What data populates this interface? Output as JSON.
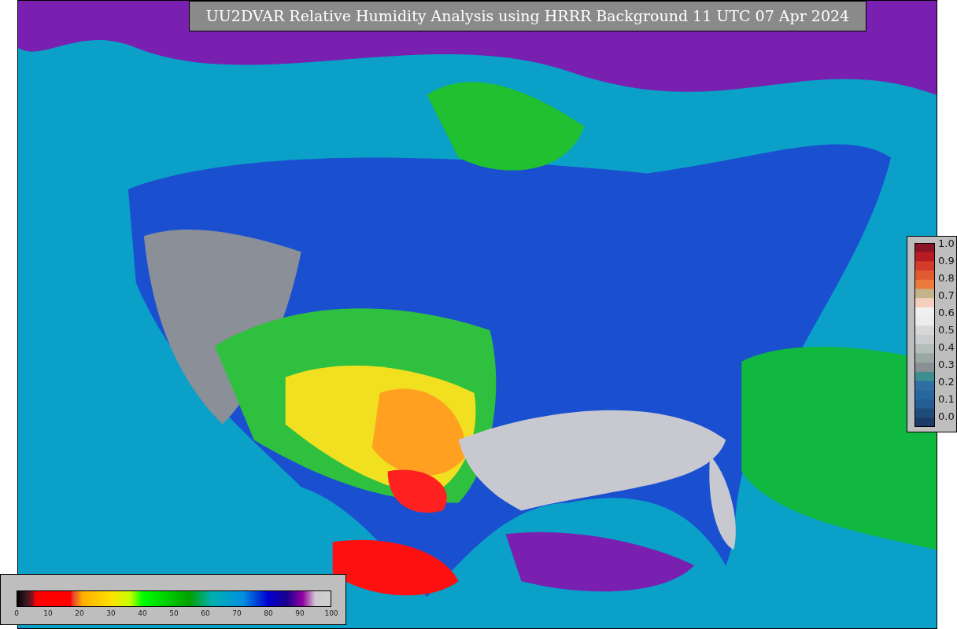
{
  "title": "UU2DVAR Relative Humidity Analysis using HRRR Background 11 UTC 07 Apr 2024",
  "humidity_legend": {
    "ticks": [
      "0",
      "10",
      "20",
      "30",
      "40",
      "50",
      "60",
      "70",
      "80",
      "90",
      "100"
    ]
  },
  "fraction_legend": {
    "ticks": [
      "1.0",
      "0.9",
      "0.8",
      "0.7",
      "0.6",
      "0.5",
      "0.4",
      "0.3",
      "0.2",
      "0.1",
      "0.0"
    ]
  }
}
